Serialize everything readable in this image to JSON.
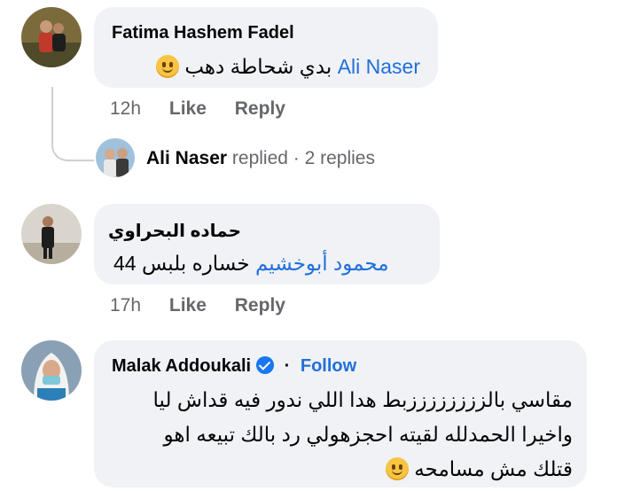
{
  "comments": [
    {
      "author": "Fatima Hashem Fadel",
      "mention": "Ali Naser",
      "text": "بدي شحاطة دهب",
      "emoji": "rolling-laughing-emoji",
      "time": "12h",
      "like": "Like",
      "reply": "Reply",
      "replied_name": "Ali Naser",
      "replied_text": "replied · 2 replies"
    },
    {
      "author": "حماده البحراوي",
      "mention": "محمود أبوخشيم",
      "text": "خساره بلبس 44",
      "time": "17h",
      "like": "Like",
      "reply": "Reply"
    },
    {
      "author": "Malak Addoukali",
      "separator": "·",
      "follow": "Follow",
      "lines": [
        "مقاسي بالززززززززبط  هدا اللي ندور فيه قداش ليا",
        "واخيرا الحمدلله لقيته احجزهولي رد بالك تبيعه اهو",
        "قتلك مش مسامحه"
      ],
      "emoji": "smirk-emoji"
    }
  ],
  "colors": {
    "bubble": "#f0f2f5",
    "link": "#216fdb",
    "meta": "#65676b",
    "verified": "#1877f2"
  }
}
